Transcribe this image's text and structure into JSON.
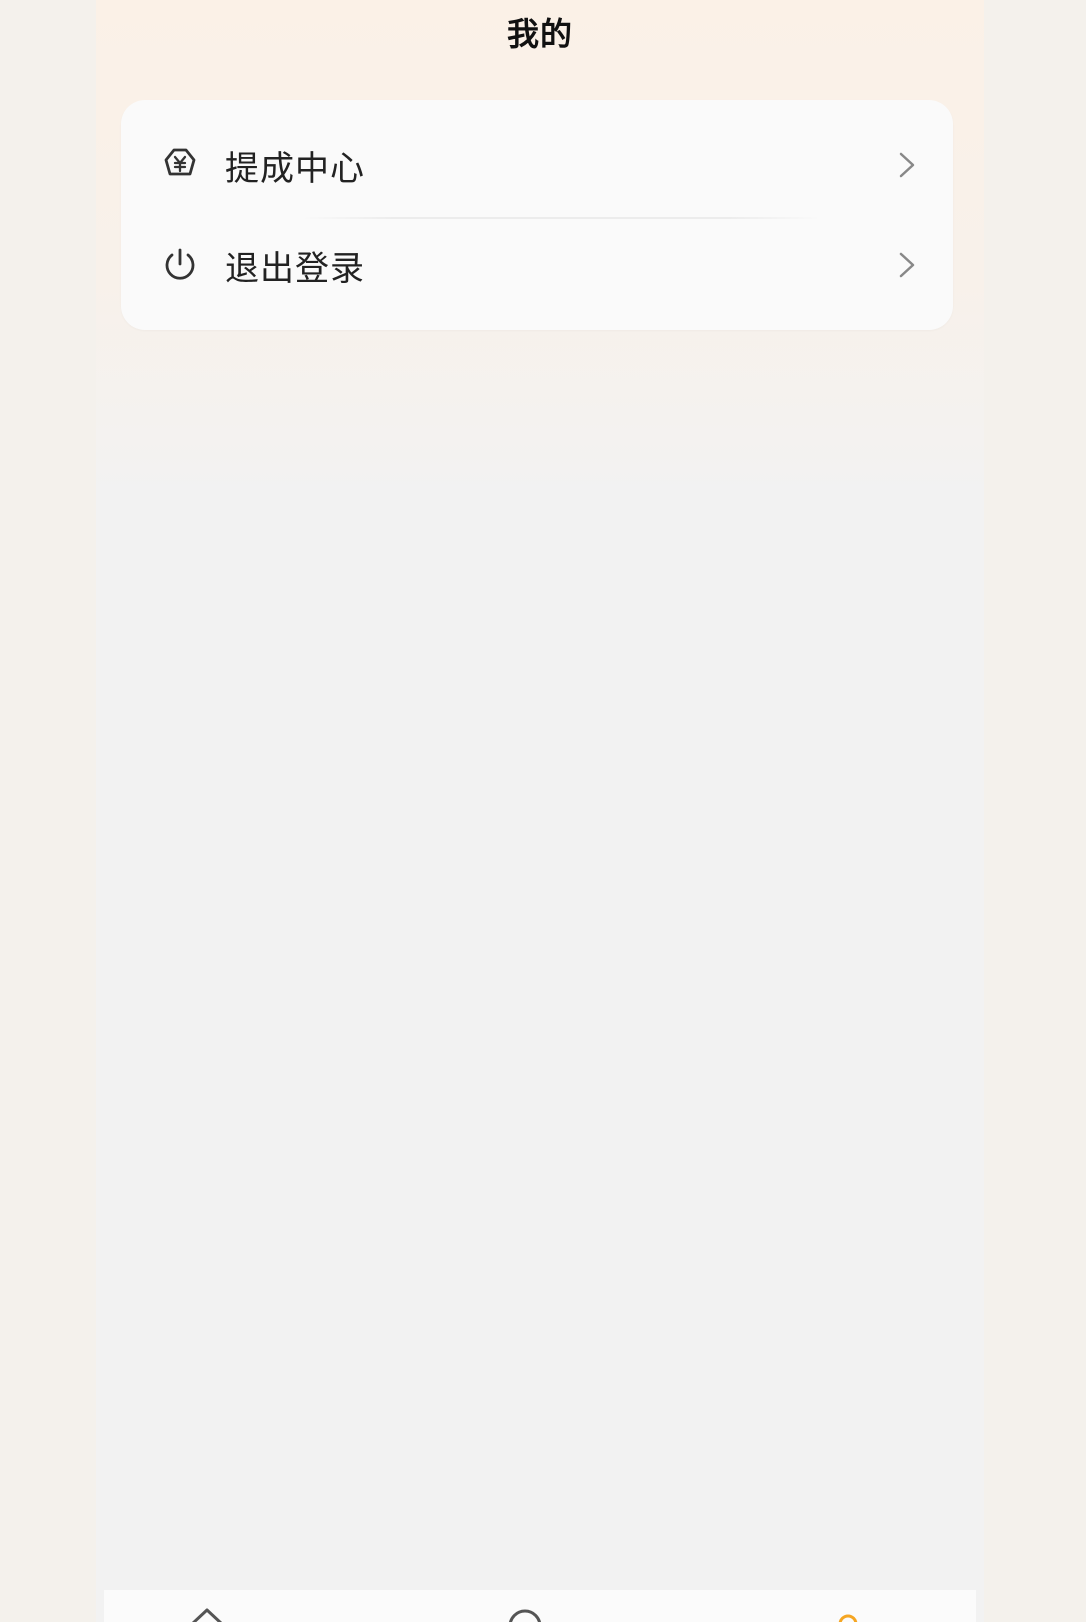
{
  "header": {
    "title": "我的"
  },
  "menu": {
    "items": [
      {
        "label": "提成中心",
        "icon": "commission-icon"
      },
      {
        "label": "退出登录",
        "icon": "power-icon"
      }
    ]
  },
  "colors": {
    "page_bg": "#f2f2f2",
    "top_tint": "#fbf1e7",
    "card_bg": "#fafafa",
    "active_tab": "#f5a623"
  },
  "tabbar": {
    "icons": [
      "home-icon",
      "message-icon",
      "profile-icon"
    ]
  }
}
